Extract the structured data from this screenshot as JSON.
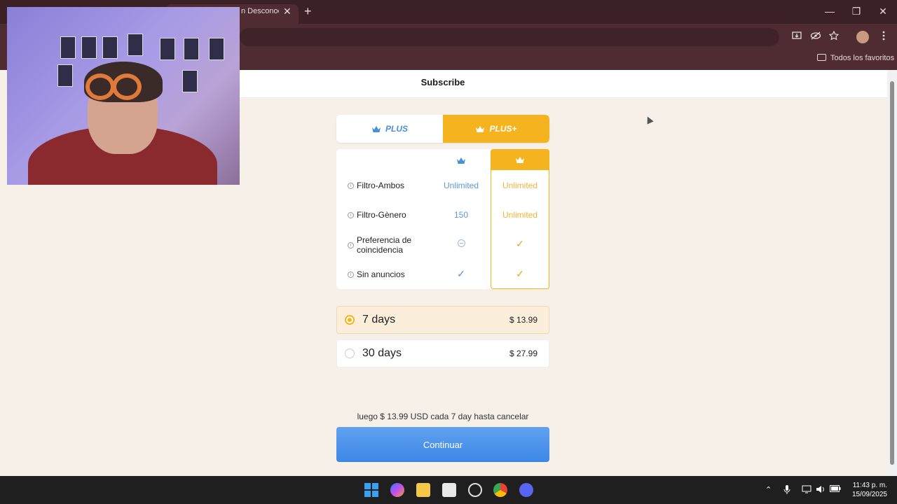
{
  "browser": {
    "tab_title": "n Desconoci",
    "tab_close": "✕",
    "new_tab": "+",
    "window": {
      "minimize": "—",
      "maximize": "❐",
      "close": "✕"
    },
    "bookmarks": {
      "favorites_label": "Todos los favoritos"
    }
  },
  "page": {
    "header_title": "Subscribe",
    "tabs": [
      {
        "label": "PLUS",
        "selected": false
      },
      {
        "label": "PLUS+",
        "selected": true
      }
    ],
    "features": [
      {
        "label": "Filtro-Ambos",
        "plus": "Unlimited",
        "plusplus": "Unlimited"
      },
      {
        "label": "Filtro-Gènero",
        "plus": "150",
        "plusplus": "Unlimited"
      },
      {
        "label": "Preferencia de coincidencia",
        "plus": "none",
        "plusplus": "check"
      },
      {
        "label": "Sin anuncios",
        "plus": "check",
        "plusplus": "check"
      }
    ],
    "plans": [
      {
        "name": "7 days",
        "price": "$ 13.99",
        "selected": true
      },
      {
        "name": "30 days",
        "price": "$ 27.99",
        "selected": false
      }
    ],
    "renewal_note": "luego $ 13.99 USD cada 7 day hasta cancelar",
    "cta_label": "Continuar"
  },
  "colors": {
    "gold": "#f5b41f",
    "blue": "#4a90d9",
    "background": "#f6f0e8"
  },
  "taskbar": {
    "time": "11:43 p. m.",
    "date": "15/09/2025"
  }
}
